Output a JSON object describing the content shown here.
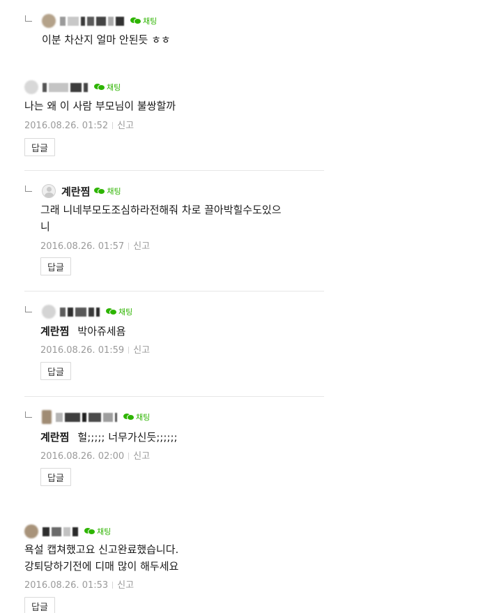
{
  "comments": [
    {
      "chat_label": "채팅",
      "text": "이분 차산지 얼마 안된듯 ㅎㅎ"
    },
    {
      "chat_label": "채팅",
      "text": "나는 왜 이 사람 부모님이 불쌍할까",
      "date": "2016.08.26. 01:52",
      "report": "신고",
      "reply": "답글"
    },
    {
      "nickname": "계란찜",
      "chat_label": "채팅",
      "text_line1": "그래 니네부모도조심하라전해줘 차로 끌아박힐수도있으",
      "text_line2": "니",
      "date": "2016.08.26. 01:57",
      "report": "신고",
      "reply": "답글"
    },
    {
      "chat_label": "채팅",
      "mention": "계란찜",
      "text": "박아쥬세욤",
      "date": "2016.08.26. 01:59",
      "report": "신고",
      "reply": "답글"
    },
    {
      "chat_label": "채팅",
      "mention": "계란찜",
      "text": "헐;;;;; 너무가신듯;;;;;;",
      "date": "2016.08.26. 02:00",
      "report": "신고",
      "reply": "답글"
    },
    {
      "chat_label": "채팅",
      "text_line1": "욕설 캡쳐했고요 신고완료했습니다.",
      "text_line2": "강퇴당하기전에 디매 많이 해두세요",
      "date": "2016.08.26. 01:53",
      "report": "신고",
      "reply": "답글"
    }
  ],
  "colors": {
    "chat_green": "#2db400",
    "meta_gray": "#9a9a9a",
    "text": "#1a1a1a"
  }
}
